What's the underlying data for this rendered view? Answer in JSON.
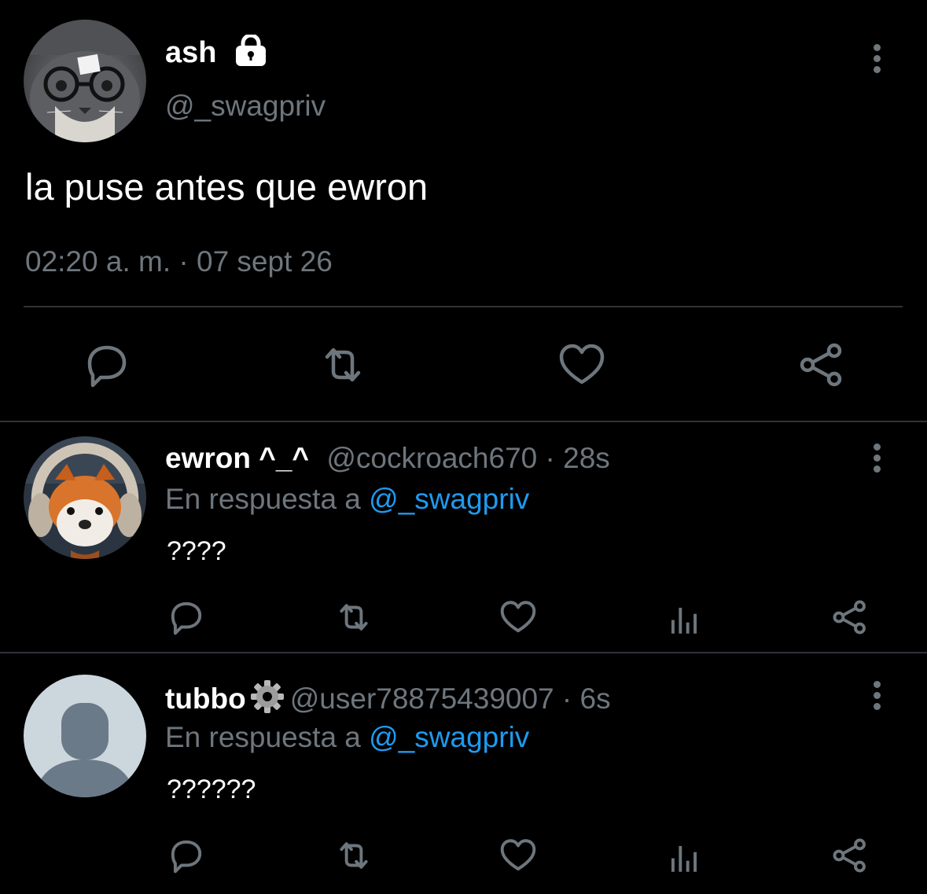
{
  "main_tweet": {
    "name": "ash",
    "handle": "@_swagpriv",
    "text": "la puse antes que ewron",
    "timestamp": "02:20 a. m. · 07 sept 26",
    "avatar_icon": "cat-with-glasses-avatar",
    "badge_icon": "lock-icon"
  },
  "replies": [
    {
      "name": "ewron ^_^",
      "handle": "@cockroach670",
      "time": "· 28s",
      "reply_prefix": "En respuesta a ",
      "reply_handle": "@_swagpriv",
      "text": "????",
      "avatar_icon": "red-panda-plush-avatar"
    },
    {
      "name": "tubbo",
      "handle": "@user78875439007",
      "time": "· 6s",
      "reply_prefix": "En respuesta a ",
      "reply_handle": "@_swagpriv",
      "text": "??????",
      "avatar_icon": "default-user-avatar",
      "badge_icon": "gear-icon"
    }
  ],
  "colors": {
    "background": "#000000",
    "text": "#ffffff",
    "muted": "#6e767d",
    "link": "#1d9bf0",
    "divider": "#2f3336"
  }
}
